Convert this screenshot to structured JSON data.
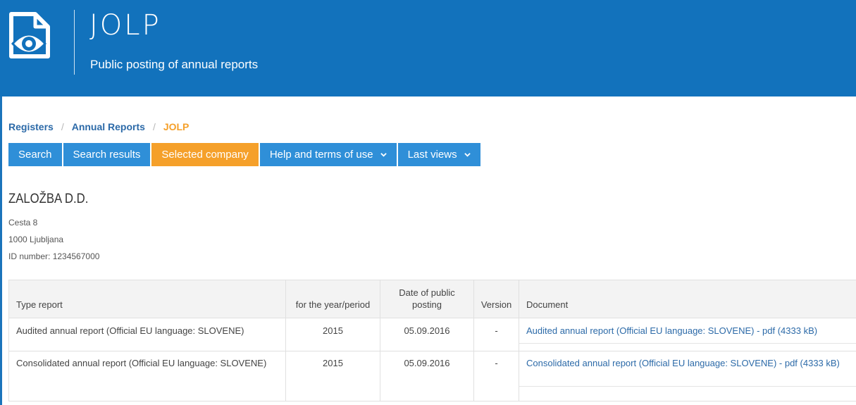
{
  "header": {
    "title": "JOLP",
    "subtitle": "Public posting of annual reports",
    "logo_icon": "document-eye-icon",
    "background": "#1272bc"
  },
  "breadcrumb": [
    {
      "label": "Registers"
    },
    {
      "label": "Annual Reports"
    },
    {
      "label": "JOLP"
    }
  ],
  "breadcrumb_separator": "/",
  "nav": {
    "search": "Search",
    "search_results": "Search results",
    "selected_company": "Selected company",
    "help": "Help and terms of use",
    "last_views": "Last views"
  },
  "company": {
    "name": "ZALOŽBA D.D.",
    "street": "Cesta 8",
    "city": "1000 Ljubljana",
    "id_line": "ID number: 1234567000"
  },
  "table": {
    "headers": {
      "type": "Type report",
      "year": "for the year/period",
      "date": "Date of public posting",
      "version": "Version",
      "document": "Document"
    },
    "rows": [
      {
        "type": "Audited annual report (Official EU language: SLOVENE)",
        "year": "2015",
        "date": "05.09.2016",
        "version": "-",
        "document": "Audited annual report (Official EU language: SLOVENE) - pdf (4333 kB)"
      },
      {
        "type": "Consolidated annual report (Official EU language: SLOVENE)",
        "year": "2015",
        "date": "05.09.2016",
        "version": "-",
        "document": "Consolidated annual report (Official EU language: SLOVENE) - pdf (4333 kB)"
      }
    ]
  },
  "colors": {
    "nav_button": "#2f8fd8",
    "nav_active": "#f5a02a",
    "link": "#2c6aa8"
  }
}
